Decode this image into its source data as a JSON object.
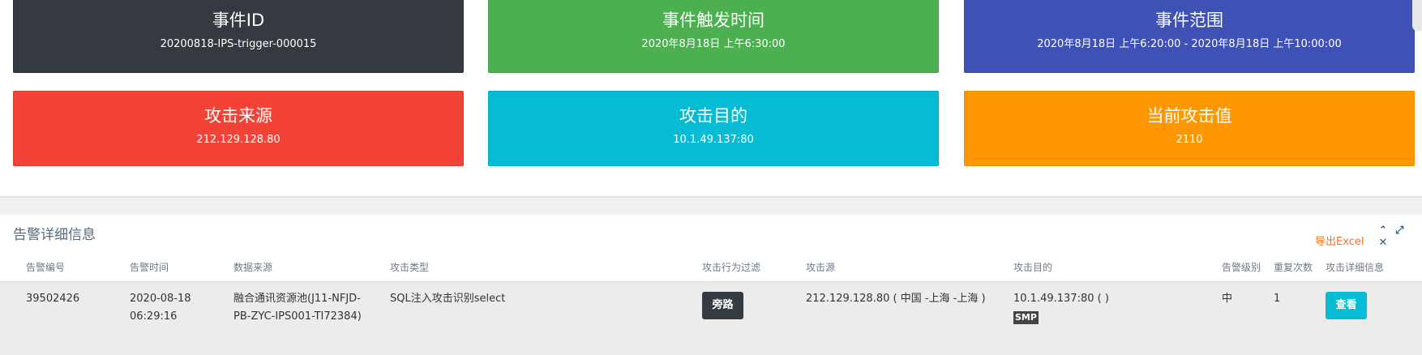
{
  "cards": [
    {
      "title": "事件ID",
      "value": "20200818-IPS-trigger-000015"
    },
    {
      "title": "事件触发时间",
      "value": "2020年8月18日 上午6:30:00"
    },
    {
      "title": "事件范围",
      "value": "2020年8月18日 上午6:20:00 - 2020年8月18日 上午10:00:00"
    },
    {
      "title": "攻击来源",
      "value": "212.129.128.80"
    },
    {
      "title": "攻击目的",
      "value": "10.1.49.137:80"
    },
    {
      "title": "当前攻击值",
      "value": "2110"
    }
  ],
  "panel": {
    "title": "告警详细信息",
    "export_label": "导出Excel",
    "tools": {
      "collapse": "⌃",
      "expand": "⤢",
      "close": "✕"
    }
  },
  "table": {
    "headers": [
      "告警编号",
      "告警时间",
      "数据来源",
      "攻击类型",
      "攻击行为过滤",
      "攻击源",
      "攻击目的",
      "告警级别",
      "重复次数",
      "攻击详细信息"
    ],
    "rows": [
      {
        "id": "39502426",
        "time": "2020-08-18 06:29:16",
        "source": "融合通讯资源池(J11-NFJD-PB-ZYC-IPS001-TI72384)",
        "attack_type": "SQL注入攻击识别select",
        "filter": "旁路",
        "attacker": "212.129.128.80 ( 中国 -上海 -上海 )",
        "target": "10.1.49.137:80 ( )",
        "target_tag": "SMP",
        "level": "中",
        "repeat": "1",
        "detail_button": "查看"
      }
    ]
  },
  "colors": {
    "card1": "#343a40",
    "card2": "#4caf50",
    "card3": "#3f51b5",
    "card4": "#f44336",
    "card5": "#06bcd5",
    "card6": "#ff9800",
    "export": "#f5731a"
  }
}
